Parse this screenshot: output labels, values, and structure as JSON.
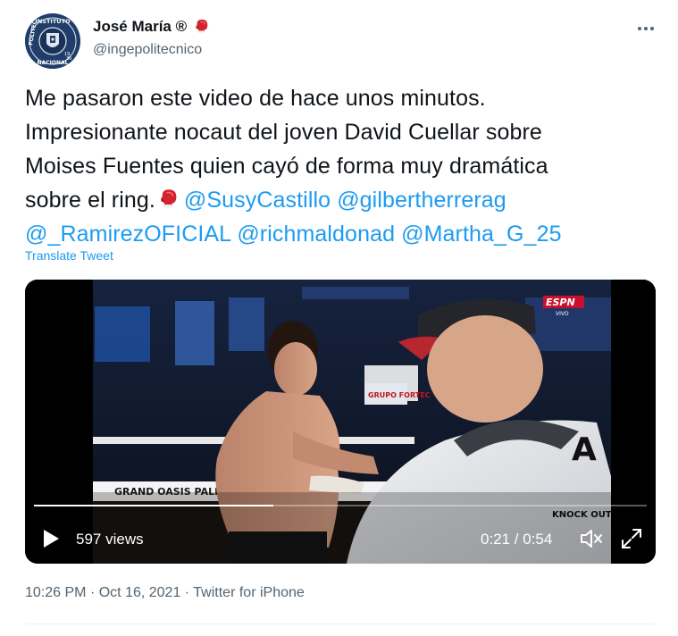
{
  "author": {
    "display_name": "José María ®",
    "handle": "@ingepolitecnico",
    "avatar": {
      "ring_text_top": "INSTITUTO POLITECNICO",
      "ring_text_bottom": "NACIONAL",
      "year_left": "19",
      "year_right": "36"
    }
  },
  "tweet": {
    "line_1": "Me pasaron este video de hace unos minutos.",
    "line_2": "Impresionante nocaut del joven David Cuellar sobre",
    "line_3": "Moises Fuentes quien cayó de forma muy dramática",
    "line_4_text": "sobre el ring.",
    "mentions": [
      "@SusyCastillo",
      "@gilbertherrerag",
      "@_RamirezOFICIAL",
      "@richmaldonad",
      "@Martha_G_25"
    ],
    "translate_label": "Translate Tweet"
  },
  "video": {
    "views": "597 views",
    "time": "0:21 / 0:54",
    "progress": 0.39,
    "broadcaster_logo": "ESPN",
    "broadcaster_sub": "VIVO",
    "ring_banner": "GRAND OASIS PALM",
    "sponsor_sign": "GRUPO FORTEC",
    "knockout_sign": "KNOCK OUT"
  },
  "footer": {
    "time": "10:26 PM",
    "date": "Oct 16, 2021",
    "source": "Twitter for iPhone",
    "separator": "·"
  },
  "colors": {
    "accent": "#1d9bf0",
    "text": "#0f1419",
    "muted": "#536471",
    "glove": "#d4232f"
  },
  "icons": [
    "more-options-icon",
    "boxing-glove-icon",
    "play-icon",
    "mute-icon",
    "fullscreen-icon"
  ]
}
